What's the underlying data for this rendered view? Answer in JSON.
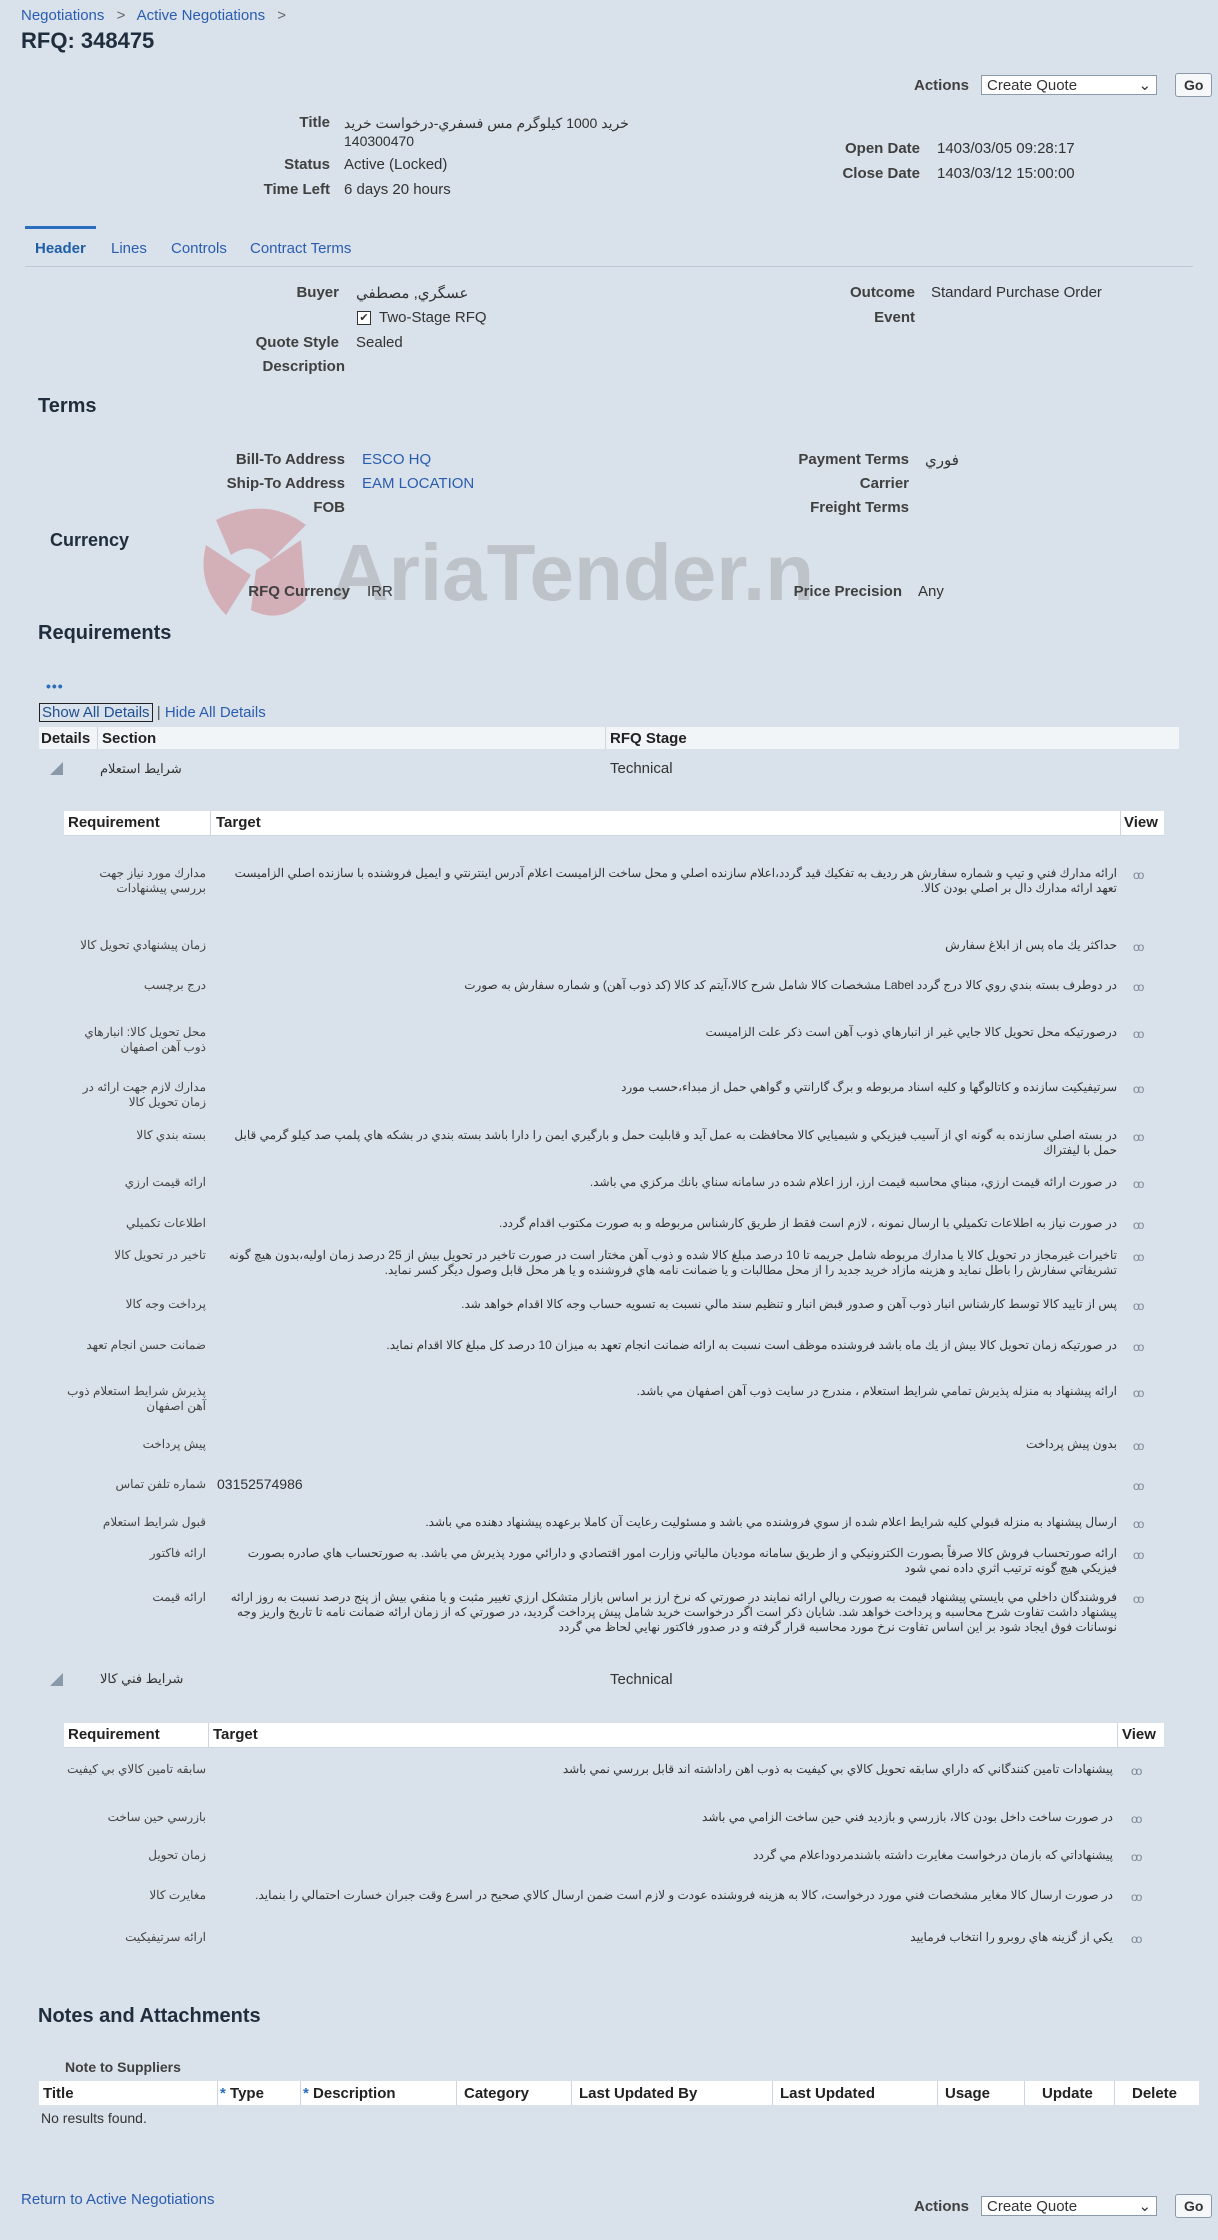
{
  "breadcrumb": {
    "item1": "Negotiations",
    "item2": "Active Negotiations",
    "sep": ">"
  },
  "page_title": "RFQ: 348475",
  "actions": {
    "label": "Actions",
    "selected": "Create Quote",
    "go_label": "Go"
  },
  "summary": {
    "title_label": "Title",
    "title_line1": "خرید 1000 کیلوگرم مس فسفري-درخواست خريد",
    "title_line2": "140300470",
    "status_label": "Status",
    "status_value": "Active (Locked)",
    "time_left_label": "Time Left",
    "time_left_value": "6 days 20 hours",
    "open_date_label": "Open Date",
    "open_date_value": "1403/03/05 09:28:17",
    "close_date_label": "Close Date",
    "close_date_value": "1403/03/12 15:00:00"
  },
  "tabs": [
    "Header",
    "Lines",
    "Controls",
    "Contract Terms"
  ],
  "header": {
    "buyer_label": "Buyer",
    "buyer_value": "عسگري, مصطفي",
    "two_stage_label": "Two-Stage RFQ",
    "quote_style_label": "Quote Style",
    "quote_style_value": "Sealed",
    "description_label": "Description",
    "outcome_label": "Outcome",
    "outcome_value": "Standard Purchase Order",
    "event_label": "Event"
  },
  "terms": {
    "heading": "Terms",
    "bill_to_label": "Bill-To Address",
    "bill_to_value": "ESCO HQ",
    "ship_to_label": "Ship-To Address",
    "ship_to_value": "EAM LOCATION",
    "fob_label": "FOB",
    "payment_terms_label": "Payment Terms",
    "payment_terms_value": "فوري",
    "carrier_label": "Carrier",
    "freight_terms_label": "Freight Terms"
  },
  "currency": {
    "heading": "Currency",
    "rfq_currency_label": "RFQ Currency",
    "rfq_currency_value": "IRR",
    "price_precision_label": "Price Precision",
    "price_precision_value": "Any"
  },
  "watermark": {
    "text": "AriaTender.neT"
  },
  "requirements": {
    "heading": "Requirements",
    "more_label": "•••",
    "show_all": "Show All Details",
    "pipe": "|",
    "hide_all": "Hide All Details",
    "columns": {
      "details": "Details",
      "section": "Section",
      "rfq_stage": "RFQ Stage"
    },
    "sub_columns": {
      "requirement": "Requirement",
      "target": "Target",
      "view": "View"
    },
    "view_icon": "oo",
    "section1": {
      "name": "شرايط استعلام",
      "stage": "Technical",
      "rows": [
        {
          "req": "مدارك مورد نياز جهت بررسي پيشنهادات",
          "target": "ارائه مدارك فني و تيپ و شماره سفارش هر رديف به تفكيك قيد گردد،اعلام سازنده اصلي و محل ساخت الزاميست اعلام آدرس اينترنتي و ايميل فروشنده با سازنده اصلي  الزاميست تعهد ارائه مدارك دال بر اصلي بودن كالا."
        },
        {
          "req": "زمان پيشنهادي تحويل كالا",
          "target": "حداكثر يك ماه پس از ابلاغ سفارش"
        },
        {
          "req": "درج برچسب",
          "target": "در دوطرف بسته بندي روي كالا درج گردد Label مشخصات كالا شامل شرح كالا،آيتم كد كالا (كد ذوب آهن) و شماره سفارش به صورت"
        },
        {
          "req": "محل تحويل كالا: انبارهاي ذوب آهن اصفهان",
          "target": "درصورتيكه محل تحويل كالا جايي غير از انبارهاي ذوب آهن است ذكر علت الزاميست"
        },
        {
          "req": "مدارك لازم جهت ارائه در زمان تحويل كالا",
          "target": "سرتيفيكيت سازنده و كاتالوگها و كليه اسناد مربوطه و برگ گارانتي و گواهي حمل از مبداء،حسب مورد"
        },
        {
          "req": "بسته بندي كالا",
          "target": "در بسته اصلي سازنده به گونه اي از آسيب فيزيكي و شيميايي كالا محافظت به عمل آيد و قابليت حمل و بارگيري ايمن را دارا باشد بسته بندي در بشكه هاي پلمپ صد كيلو گرمي قابل حمل با ليفتراك"
        },
        {
          "req": "ارائه قيمت ارزي",
          "target": "در صورت ارائه قيمت ارزي، مبناي محاسبه قيمت ارز، ارز اعلام شده در سامانه سناي بانك مركزي مي باشد."
        },
        {
          "req": "اطلاعات تكميلي",
          "target": "در صورت نياز به اطلاعات تكميلي با ارسال نمونه ، لازم است فقط از طريق كارشناس مربوطه و به صورت مكتوب اقدام گردد."
        },
        {
          "req": "تاخير در تحويل كالا",
          "target": "تاخيرات غيرمجاز در تحويل كالا يا مدارك مربوطه شامل جريمه تا 10 درصد مبلغ كالا شده و ذوب آهن مختار است در صورت تاخير در تحويل بيش از 25 درصد زمان اوليه،بدون هيچ گونه تشريفاتي سفارش را باطل نمايد و هزينه مازاد خريد جديد را از محل مطالبات و يا ضمانت نامه هاي فروشنده و يا هر محل قابل وصول ديگر كسر نمايد."
        },
        {
          "req": "پرداخت وجه كالا",
          "target": "پس از تاييد كالا توسط كارشناس انبار ذوب آهن و صدور قبض انبار و تنظيم سند مالي نسبت به تسويه حساب وجه كالا اقدام خواهد شد."
        },
        {
          "req": "ضمانت حسن انجام تعهد",
          "target": "در صورتيكه زمان تحويل كالا بيش از يك ماه باشد فروشنده موظف است نسبت به ارائه ضمانت انجام تعهد به ميزان 10 درصد كل مبلغ كالا اقدام نمايد."
        },
        {
          "req": "پذيرش شرايط استعلام ذوب آهن اصفهان",
          "target": "ارائه پيشنهاد به منزله پذيرش تمامي شرايط استعلام ، مندرج در سايت ذوب آهن اصفهان مي باشد."
        },
        {
          "req": "پيش پرداخت",
          "target": "بدون پيش پرداخت"
        },
        {
          "req": "شماره تلفن تماس",
          "target": "03152574986"
        },
        {
          "req": "قبول شرايط استعلام",
          "target": "ارسال پيشنهاد به منزله قبولي كليه شرايط اعلام شده از سوي فروشنده مي باشد و مسئوليت رعايت آن كاملا برعهده پيشنهاد دهنده مي باشد."
        },
        {
          "req": "ارائه فاكتور",
          "target": "ارائه صورتحساب فروش كالا صرفاً بصورت الكترونيكي و از طريق سامانه موديان مالياتي وزارت امور اقتصادي و دارائي مورد پذيرش مي باشد.  به صورتحساب هاي صادره بصورت فيزيكي هيچ گونه ترتيب اثري داده نمي شود"
        },
        {
          "req": "ارائه قيمت",
          "target": "فروشندگان داخلي مي بايستي پيشنهاد قيمت به صورت ريالي ارائه نمايند در صورتي كه نرخ ارز بر اساس بازار متشكل ارزي تغيير مثبت و يا منفي بيش از پنج درصد نسبت به روز ارائه پيشنهاد داشت تفاوت شرح محاسبه و پرداخت خواهد شد. شايان ذكر است اگر درخواست خريد شامل پيش پرداخت گرديد، در صورتي كه از زمان ارائه ضمانت نامه تا تاريخ واريز وجه نوسانات فوق ايجاد شود بر اين اساس تفاوت نرخ مورد محاسبه قرار گرفته و در صدور فاكتور نهايي لحاظ مي گردد"
        }
      ]
    },
    "section2": {
      "name": "شرايط فني كالا",
      "stage": "Technical",
      "rows": [
        {
          "req": "سابقه تامين كالاي بي كيفيت",
          "target": "پيشنهادات تامين كنندگاني كه داراي سابقه تحويل كالاي بي كيفيت به ذوب اهن راداشته اند قابل بررسي نمي باشد"
        },
        {
          "req": "بازرسي حين ساخت",
          "target": "در صورت ساخت داخل بودن كالا، بازرسي و بازديد فني حين ساخت الزامي مي باشد"
        },
        {
          "req": "زمان تحويل",
          "target": "پيشنهاداتي كه بازمان درخواست مغايرت داشته باشندمردوداعلام مي گردد"
        },
        {
          "req": "مغايرت كالا",
          "target": "در صورت ارسال كالا مغاير مشخصات فني مورد درخواست، كالا به هزينه فروشنده عودت و لازم است ضمن ارسال كالاي صحيح در اسرع وقت جبران خسارت احتمالي را بنمايد."
        },
        {
          "req": "ارائه سرتيفيكيت",
          "target": "يكي از گزينه هاي روبرو را انتخاب فرماييد"
        }
      ]
    }
  },
  "notes": {
    "heading": "Notes and Attachments",
    "note_to_suppliers": "Note to Suppliers",
    "required_star": "*",
    "columns": [
      "Title",
      "Type",
      "Description",
      "Category",
      "Last Updated By",
      "Last Updated",
      "Usage",
      "Update",
      "Delete"
    ],
    "empty": "No results found."
  },
  "footer": {
    "return_link": "Return to Active Negotiations"
  }
}
